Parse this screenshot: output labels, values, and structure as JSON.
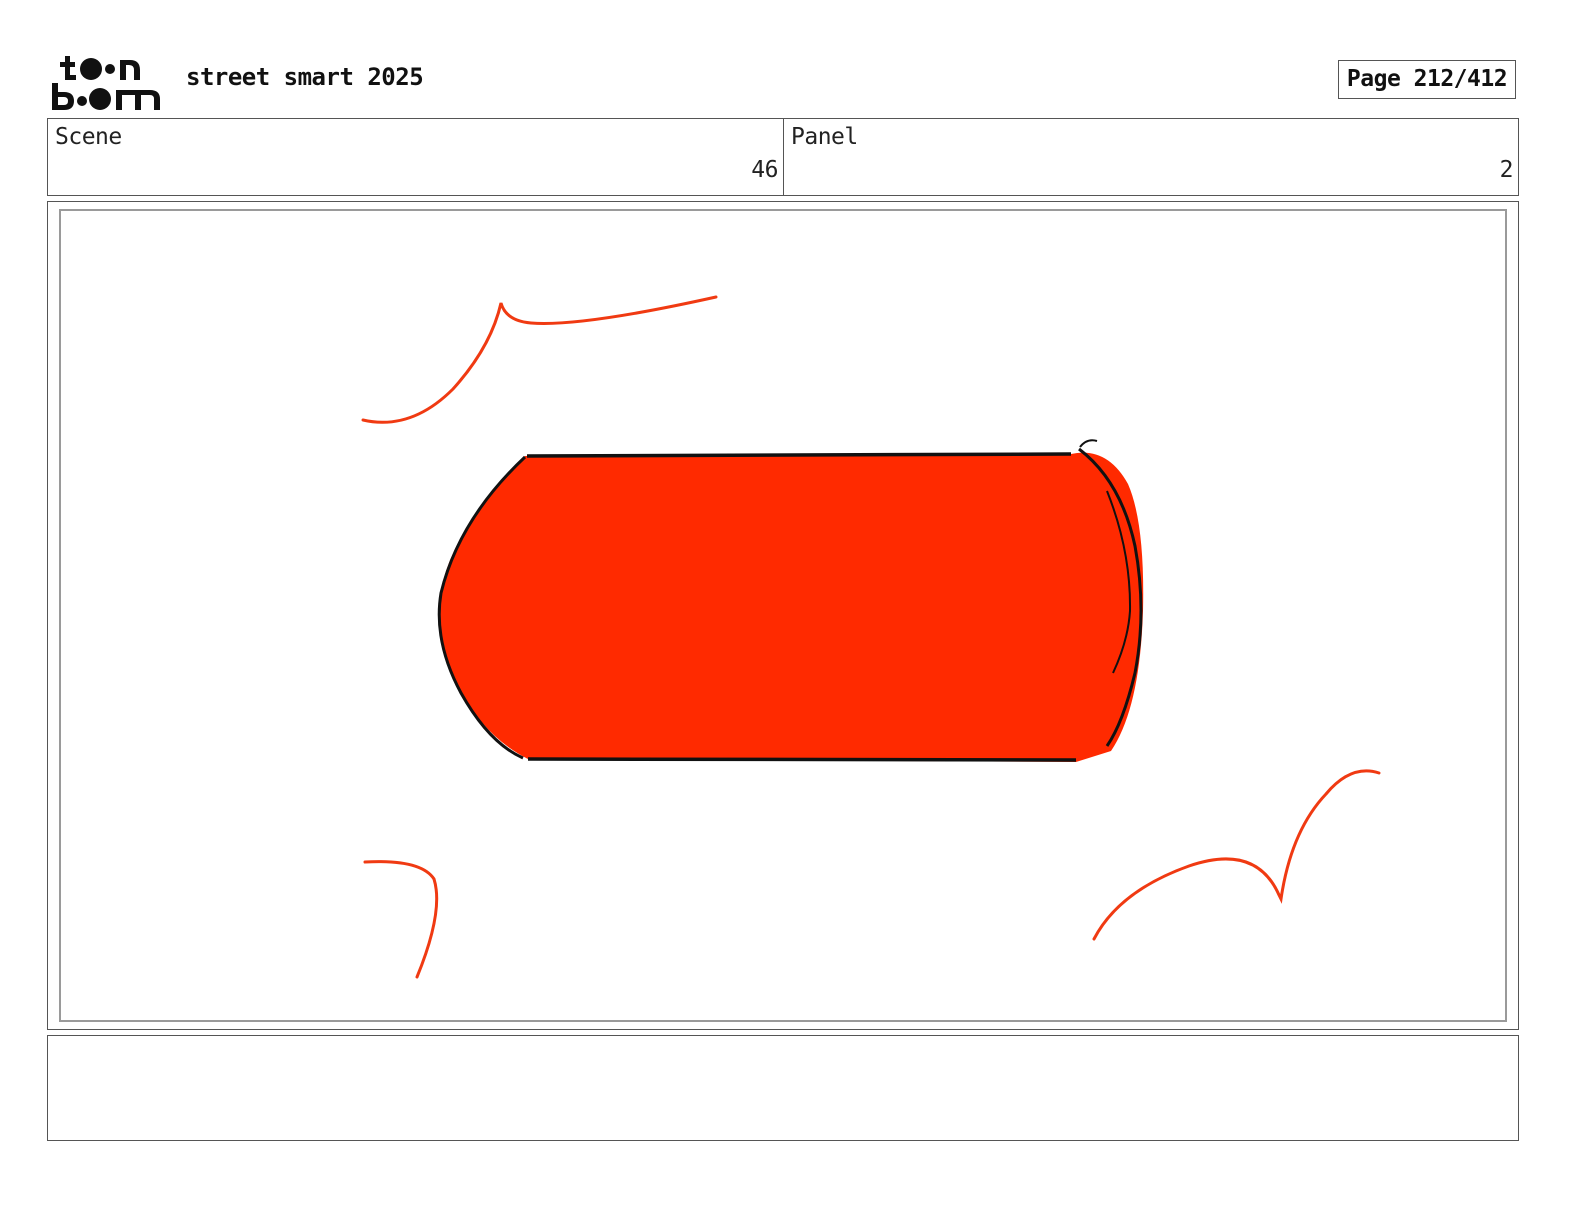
{
  "header": {
    "logo_icon": "toonboom-logo-icon",
    "logo_text_top": "toon",
    "logo_text_bottom": "boom",
    "project_title": "street smart 2025",
    "page_label": "Page 212/412"
  },
  "info": {
    "scene_label": "Scene",
    "scene_value": "46",
    "panel_label": "Panel",
    "panel_value": "2"
  },
  "artwork": {
    "fill_color": "#ff2a00",
    "outline_color": "#111111",
    "accent_color": "#f03a12"
  },
  "notes": {
    "text": ""
  }
}
